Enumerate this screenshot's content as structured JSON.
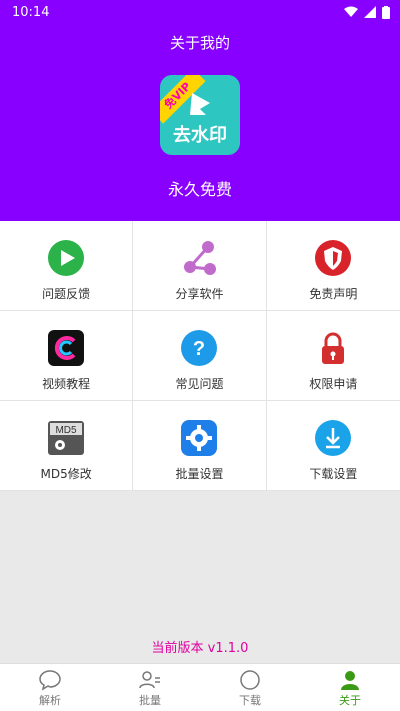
{
  "status": {
    "time": "10:14"
  },
  "header": {
    "title": "关于我的",
    "app_icon": {
      "ribbon": "免VIP",
      "text": "去水印"
    },
    "subtitle": "永久免费"
  },
  "grid": {
    "items": [
      {
        "label": "问题反馈",
        "icon": "play-icon",
        "color": "#2bb34a"
      },
      {
        "label": "分享软件",
        "icon": "share-icon",
        "color": "#c06bcb"
      },
      {
        "label": "免责声明",
        "icon": "shield-icon",
        "color": "#d9232b"
      },
      {
        "label": "视频教程",
        "icon": "video-logo-icon",
        "color": "#111111"
      },
      {
        "label": "常见问题",
        "icon": "question-icon",
        "color": "#1e9be8"
      },
      {
        "label": "权限申请",
        "icon": "lock-icon",
        "color": "#d32f2f"
      },
      {
        "label": "MD5修改",
        "icon": "md5-icon",
        "color": "#555555"
      },
      {
        "label": "批量设置",
        "icon": "gear-icon",
        "color": "#1e7fe8"
      },
      {
        "label": "下载设置",
        "icon": "download-icon",
        "color": "#1aa3e8"
      }
    ],
    "md5_text": "MD5"
  },
  "version": "当前版本 v1.1.0",
  "nav": {
    "items": [
      {
        "label": "解析",
        "icon": "chat-icon",
        "active": false
      },
      {
        "label": "批量",
        "icon": "user-list-icon",
        "active": false
      },
      {
        "label": "下载",
        "icon": "compass-icon",
        "active": false
      },
      {
        "label": "关于",
        "icon": "user-icon",
        "active": true
      }
    ]
  }
}
